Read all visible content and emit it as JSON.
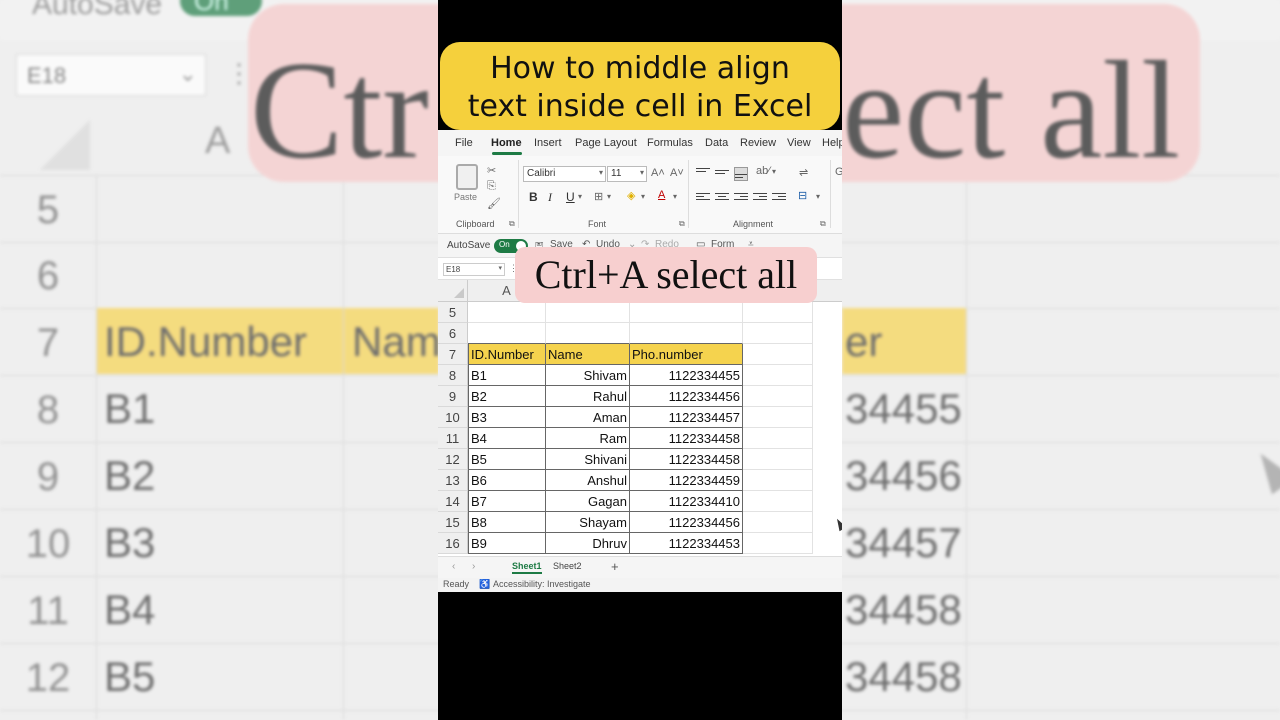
{
  "title": {
    "line1": "How to middle align",
    "line2": "text inside cell in Excel"
  },
  "banner": "Ctrl+A select all",
  "ribbon": {
    "tabs": [
      "File",
      "Home",
      "Insert",
      "Page Layout",
      "Formulas",
      "Data",
      "Review",
      "View",
      "Help"
    ],
    "active_tab": "Home",
    "paste_label": "Paste",
    "groups": {
      "clipboard": "Clipboard",
      "font": "Font",
      "alignment": "Alignment"
    },
    "font_name": "Calibri",
    "font_size": "11",
    "bold": "B",
    "italic": "I",
    "underline": "U"
  },
  "qat": {
    "autosave": "AutoSave",
    "toggle": "On",
    "save": "Save",
    "undo": "Undo",
    "redo": "Redo",
    "form": "Form"
  },
  "namebox": "E18",
  "column_header": "A",
  "rows": [
    {
      "num": "5",
      "a": "",
      "b": "",
      "c": ""
    },
    {
      "num": "6",
      "a": "",
      "b": "",
      "c": ""
    },
    {
      "num": "7",
      "a": "ID.Number",
      "b": "Name",
      "c": "Pho.number"
    },
    {
      "num": "8",
      "a": "B1",
      "b": "Shivam",
      "c": "1122334455"
    },
    {
      "num": "9",
      "a": "B2",
      "b": "Rahul",
      "c": "1122334456"
    },
    {
      "num": "10",
      "a": "B3",
      "b": "Aman",
      "c": "1122334457"
    },
    {
      "num": "11",
      "a": "B4",
      "b": "Ram",
      "c": "1122334458"
    },
    {
      "num": "12",
      "a": "B5",
      "b": "Shivani",
      "c": "1122334458"
    },
    {
      "num": "13",
      "a": "B6",
      "b": "Anshul",
      "c": "1122334459"
    },
    {
      "num": "14",
      "a": "B7",
      "b": "Gagan",
      "c": "1122334410"
    },
    {
      "num": "15",
      "a": "B8",
      "b": "Shayam",
      "c": "1122334456"
    },
    {
      "num": "16",
      "a": "B9",
      "b": "Dhruv",
      "c": "1122334453"
    }
  ],
  "sheets": [
    "Sheet1",
    "Sheet2"
  ],
  "active_sheet": "Sheet1",
  "status": {
    "ready": "Ready",
    "accessibility": "Accessibility: Investigate"
  },
  "background": {
    "autosave": "AutoSave",
    "toggle": "On",
    "namebox": "E18",
    "column_header": "A",
    "big_left": "Ctr",
    "big_right": "ect all",
    "rows": [
      {
        "num": "5",
        "a": "",
        "b": "",
        "c": ""
      },
      {
        "num": "6",
        "a": "",
        "b": "",
        "c": ""
      },
      {
        "num": "7",
        "a": "ID.Number",
        "b": "Nam",
        "c": "er"
      },
      {
        "num": "8",
        "a": "B1",
        "b": "",
        "c": "34455"
      },
      {
        "num": "9",
        "a": "B2",
        "b": "",
        "c": "34456"
      },
      {
        "num": "10",
        "a": "B3",
        "b": "",
        "c": "34457"
      },
      {
        "num": "11",
        "a": "B4",
        "b": "",
        "c": "34458"
      },
      {
        "num": "12",
        "a": "B5",
        "b": "",
        "c": "34458"
      }
    ]
  },
  "colors": {
    "title_bg": "#f5d03c",
    "banner_bg": "#f7cfcf",
    "header_fill": "#f5d34e",
    "excel_green": "#1e7b45"
  }
}
